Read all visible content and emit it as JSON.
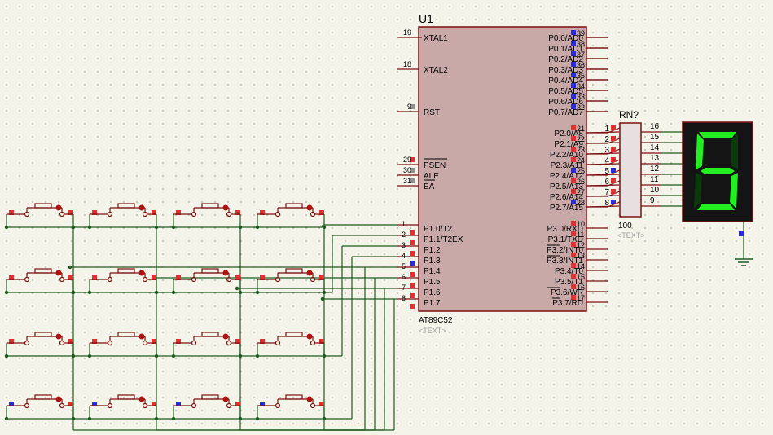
{
  "mcu": {
    "ref": "U1",
    "part": "AT89C52",
    "text_tag": "<TEXT>",
    "left_pins": [
      {
        "num": "19",
        "label": "XTAL1"
      },
      {
        "num": "18",
        "label": "XTAL2"
      },
      {
        "num": "9",
        "label": "RST"
      },
      {
        "num": "29",
        "label": "PSEN"
      },
      {
        "num": "30",
        "label": "ALE"
      },
      {
        "num": "31",
        "label": "EA"
      }
    ],
    "p1_pins": [
      {
        "num": "1",
        "label": "P1.0/T2"
      },
      {
        "num": "2",
        "label": "P1.1/T2EX"
      },
      {
        "num": "3",
        "label": "P1.2"
      },
      {
        "num": "4",
        "label": "P1.3"
      },
      {
        "num": "5",
        "label": "P1.4"
      },
      {
        "num": "6",
        "label": "P1.5"
      },
      {
        "num": "7",
        "label": "P1.6"
      },
      {
        "num": "8",
        "label": "P1.7"
      }
    ],
    "p0_pins": [
      {
        "num": "39",
        "label": "P0.0/AD0"
      },
      {
        "num": "38",
        "label": "P0.1/AD1"
      },
      {
        "num": "37",
        "label": "P0.2/AD2"
      },
      {
        "num": "36",
        "label": "P0.3/AD3"
      },
      {
        "num": "35",
        "label": "P0.4/AD4"
      },
      {
        "num": "34",
        "label": "P0.5/AD5"
      },
      {
        "num": "33",
        "label": "P0.6/AD6"
      },
      {
        "num": "32",
        "label": "P0.7/AD7"
      }
    ],
    "p2_pins": [
      {
        "num": "21",
        "label": "P2.0/A8"
      },
      {
        "num": "22",
        "label": "P2.1/A9"
      },
      {
        "num": "23",
        "label": "P2.2/A10"
      },
      {
        "num": "24",
        "label": "P2.3/A11"
      },
      {
        "num": "25",
        "label": "P2.4/A12"
      },
      {
        "num": "26",
        "label": "P2.5/A13"
      },
      {
        "num": "27",
        "label": "P2.6/A14"
      },
      {
        "num": "28",
        "label": "P2.7/A15"
      }
    ],
    "p3_pins": [
      {
        "num": "10",
        "label": "P3.0/RXD"
      },
      {
        "num": "11",
        "label": "P3.1/TXD"
      },
      {
        "num": "12",
        "label": "P3.2/INT0"
      },
      {
        "num": "13",
        "label": "P3.3/INT1"
      },
      {
        "num": "14",
        "label": "P3.4/T0"
      },
      {
        "num": "15",
        "label": "P3.5/T1"
      },
      {
        "num": "16",
        "label": "P3.6/WR"
      },
      {
        "num": "17",
        "label": "P3.7/RD"
      }
    ]
  },
  "rn": {
    "ref": "RN?",
    "value": "100",
    "text_tag": "<TEXT>",
    "left_pins": [
      "1",
      "2",
      "3",
      "4",
      "5",
      "6",
      "7",
      "8"
    ],
    "right_pins": [
      "16",
      "15",
      "14",
      "13",
      "12",
      "11",
      "10",
      "9"
    ]
  },
  "display": {
    "digit": "5",
    "segments_on": [
      "a",
      "f",
      "g",
      "c",
      "d"
    ],
    "segment_on_color": "#22ee22",
    "segment_off_color": "#0c3a0c",
    "body_color": "#141414"
  },
  "keypad": {
    "rows": 4,
    "cols": 4
  },
  "colors": {
    "wire": "#1f5a1f",
    "component": "#7a1010",
    "pin_red": "#e23030",
    "pin_blue": "#2a2ae0",
    "grid_dot": "#a8a89a",
    "chip_fill": "#c9a8a8",
    "label": "#000000",
    "tag_text": "#a0a0a0"
  }
}
